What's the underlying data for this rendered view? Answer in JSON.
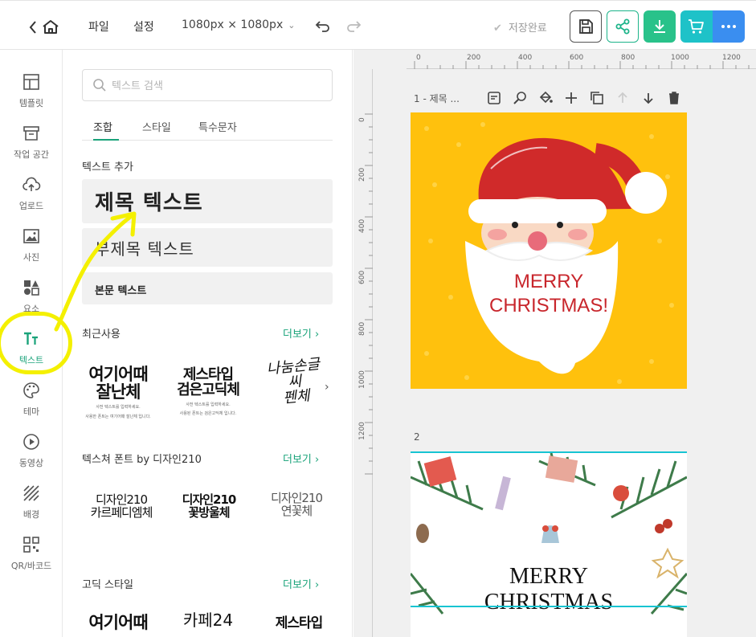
{
  "topbar": {
    "menu": {
      "file": "파일",
      "settings": "설정"
    },
    "canvas_size": "1080px × 1080px",
    "save_status": "저장완료",
    "colors": {
      "share": "#1db48a",
      "download": "#29c28a",
      "cart": "#1ec2c8",
      "more": "#3a8ef0"
    }
  },
  "rail": {
    "items": [
      {
        "label": "템플릿",
        "icon": "template-icon"
      },
      {
        "label": "작업 공간",
        "icon": "workspace-icon"
      },
      {
        "label": "업로드",
        "icon": "upload-icon"
      },
      {
        "label": "사진",
        "icon": "photo-icon"
      },
      {
        "label": "요소",
        "icon": "elements-icon"
      },
      {
        "label": "텍스트",
        "icon": "text-icon"
      },
      {
        "label": "테마",
        "icon": "palette-icon"
      },
      {
        "label": "동영상",
        "icon": "video-icon"
      },
      {
        "label": "배경",
        "icon": "background-icon"
      },
      {
        "label": "QR/바코드",
        "icon": "qr-icon"
      }
    ],
    "active_index": 5
  },
  "panel": {
    "search_placeholder": "텍스트 검색",
    "tabs": [
      "조합",
      "스타일",
      "특수문자"
    ],
    "active_tab": 0,
    "add_section_title": "텍스트 추가",
    "add_title": "제목 텍스트",
    "add_subtitle": "부제목 텍스트",
    "add_body": "본문 텍스트",
    "recent": {
      "title": "최근사용",
      "more": "더보기",
      "fonts": [
        {
          "name_line1": "여기어때",
          "name_line2": "잘난체",
          "desc_line1": "사전 텍스트를 입력하세요.",
          "desc_line2": "사용한 폰트는 여기어때 잘난체 입니다."
        },
        {
          "name_line1": "제스타입",
          "name_line2": "검은고딕체",
          "desc_line1": "사전 텍스트를 입력하세요.",
          "desc_line2": "사용된 폰트는 검은고딕체 입니다."
        },
        {
          "name_line1": "나눔손글씨",
          "name_line2": "펜체",
          "desc_line1": "",
          "desc_line2": ""
        }
      ]
    },
    "texture": {
      "title": "텍스쳐 폰트 by 디자인210",
      "more": "더보기",
      "fonts": [
        {
          "name_line1": "디자인210",
          "name_line2": "카르페디엠체"
        },
        {
          "name_line1": "디자인210",
          "name_line2": "꽃방울체"
        },
        {
          "name_line1": "디자인210",
          "name_line2": "연꽃체"
        }
      ]
    },
    "gothic": {
      "title": "고딕 스타일",
      "more": "더보기",
      "fonts": [
        {
          "name_line1": "여기어때"
        },
        {
          "name_line1": "카페24"
        },
        {
          "name_line1": "제스타입"
        }
      ]
    }
  },
  "canvas": {
    "ruler_top": [
      "0",
      "200",
      "400",
      "600",
      "800",
      "1000",
      "1200"
    ],
    "ruler_left": [
      "0",
      "200",
      "400",
      "600",
      "800",
      "1000",
      "1200"
    ],
    "page1_name": "1 - 제목 ...",
    "page1_text_line1": "MERRY",
    "page1_text_line2": "CHRISTMAS!",
    "page2_label": "2",
    "page2_text_line1": "MERRY",
    "page2_text_line2": "CHRISTMAS",
    "colors": {
      "page1_bg": "#ffc10d",
      "santa_red": "#d02a2a",
      "text_red": "#c8262c",
      "selection": "#18c4d2"
    }
  }
}
